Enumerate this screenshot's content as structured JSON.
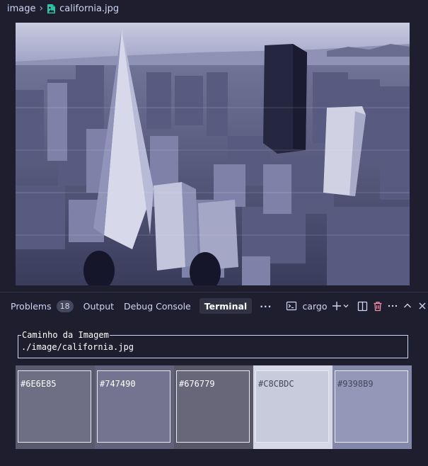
{
  "breadcrumb": {
    "folder": "image",
    "file": "california.jpg",
    "icon": "image-file-icon"
  },
  "preview": {
    "alt": "california.jpg",
    "tint": "#8086c0"
  },
  "panel": {
    "tabs": [
      {
        "label": "Problems",
        "badge": "18"
      },
      {
        "label": "Output"
      },
      {
        "label": "Debug Console"
      },
      {
        "label": "Terminal",
        "active": true
      }
    ],
    "more": "···",
    "terminal_name": "cargo",
    "icons": [
      "terminal-icon",
      "plus-icon",
      "chevron-down-icon",
      "split-icon",
      "trash-icon",
      "more-icon",
      "chevron-up-icon",
      "close-icon"
    ]
  },
  "terminal": {
    "label": "Caminho da Imagem",
    "path": "./image/california.jpg"
  },
  "palette": [
    {
      "hex": "#6E6E85",
      "text_color": "#ffffff",
      "outer": "#5a5a6e"
    },
    {
      "hex": "#747490",
      "text_color": "#ffffff",
      "outer": "#62627c"
    },
    {
      "hex": "#676779",
      "text_color": "#ffffff",
      "outer": "#585868"
    },
    {
      "hex": "#C8CBDC",
      "text_color": "#45475a",
      "outer": "#d5d8e6"
    },
    {
      "hex": "#9398B9",
      "text_color": "#45475a",
      "outer": "#8488a8"
    }
  ]
}
